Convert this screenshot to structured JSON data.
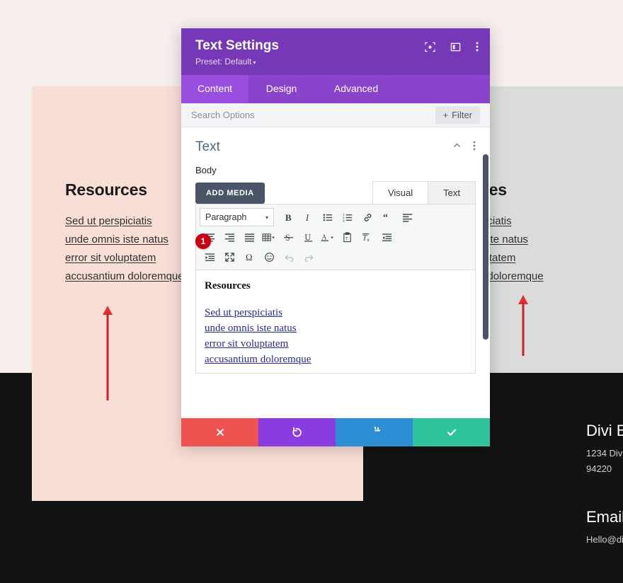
{
  "background": {
    "colors": {
      "page": "#f7efeb",
      "pink_panel": "#f9ded6",
      "gray_panel": "#d9dcd8",
      "dark_footer": "#131313"
    },
    "left_column": {
      "title": "Resources",
      "links": [
        "Sed ut perspiciatis",
        "unde omnis iste natus",
        "error sit voluptatem",
        "accusantium doloremque"
      ]
    },
    "right_column": {
      "title": "Resources",
      "links": [
        "Sed ut perspiciatis",
        "unde omnis iste natus",
        "error sit voluptatem",
        "accusantium doloremque"
      ]
    },
    "footer": {
      "heading_1": "Divi B",
      "address_line_1": "1234 Divi",
      "address_line_2": "94220",
      "heading_2": "Email",
      "email_line": "Hello@di"
    }
  },
  "annotations": {
    "arrow_color": "#cc2026",
    "step_badge": "1"
  },
  "modal": {
    "title": "Text Settings",
    "preset": "Preset: Default",
    "preset_caret": "▾",
    "header_icons": [
      {
        "name": "focus-icon"
      },
      {
        "name": "layout-panel-icon"
      },
      {
        "name": "more-vertical-icon"
      }
    ],
    "tabs": [
      {
        "label": "Content",
        "active": true
      },
      {
        "label": "Design",
        "active": false
      },
      {
        "label": "Advanced",
        "active": false
      }
    ],
    "search": {
      "placeholder": "Search Options",
      "value": ""
    },
    "filter_button": {
      "plus": "+",
      "label": "Filter"
    },
    "section": {
      "title": "Text",
      "collapse_icon": "chevron-up-icon",
      "menu_icon": "more-vertical-icon"
    },
    "field_label": "Body",
    "add_media_label": "ADD MEDIA",
    "editor_tabs": [
      {
        "label": "Visual",
        "active": true
      },
      {
        "label": "Text",
        "active": false
      }
    ],
    "toolbar": {
      "format_select": "Paragraph",
      "format_caret": "▾",
      "row1": [
        "bold-icon",
        "italic-icon",
        "bulleted-list-icon",
        "numbered-list-icon",
        "link-icon",
        "blockquote-icon",
        "align-left-icon"
      ],
      "row2": [
        "align-center-icon",
        "align-right-icon",
        "align-justify-icon",
        "table-icon",
        "strikethrough-icon",
        "underline-icon",
        "text-color-icon",
        "paste-as-text-icon",
        "clear-formatting-icon",
        "outdent-icon"
      ],
      "row3": [
        "indent-icon",
        "fullscreen-icon",
        "special-character-icon",
        "emoji-icon",
        "undo-icon",
        "redo-icon"
      ]
    },
    "content": {
      "heading": "Resources",
      "links": [
        "Sed ut perspiciatis",
        "unde omnis iste natus",
        "error sit voluptatem",
        "accusantium doloremque"
      ]
    },
    "footer_buttons": [
      {
        "name": "cancel-button",
        "icon": "✖",
        "color": "#ef5350"
      },
      {
        "name": "undo-button",
        "icon": "↺",
        "color": "#8a3ce0"
      },
      {
        "name": "redo-button",
        "icon": "↻",
        "color": "#2d8ed4"
      },
      {
        "name": "save-button",
        "icon": "✔",
        "color": "#2fc39b"
      }
    ]
  }
}
